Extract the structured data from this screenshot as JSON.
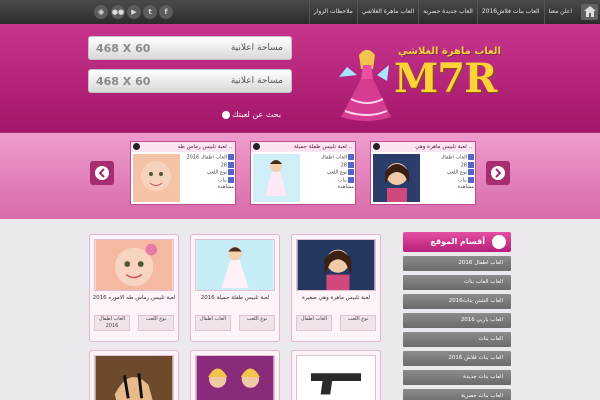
{
  "topbar": {
    "social_icons": [
      "facebook-icon",
      "twitter-icon",
      "youtube-icon",
      "flickr-icon",
      "rss-icon"
    ],
    "menu": [
      "اعلن معنا",
      "العاب بنات فلاش2016",
      "العاب جديدة حصرية",
      "العاب ماهرة الغلاشي",
      "ملاحظات الزوار"
    ]
  },
  "header": {
    "ads": [
      {
        "size": "468 X 60",
        "label": "مساحة اعلانية"
      },
      {
        "size": "468 X 60",
        "label": "مساحة اعلانية"
      }
    ],
    "logo_text": "M7R",
    "logo_arabic": "العاب ماهرة الغلاشي",
    "search_link": "بحث عن لعبتك"
  },
  "slider": {
    "cards": [
      {
        "title": "لعبة تلبيس رماس طه ..",
        "info": [
          "العاب اطفال 2016",
          "28",
          "نوع اللعب",
          "بنات",
          "مشاهدة"
        ]
      },
      {
        "title": "لعبة تلبيس طفلة جميلة ..",
        "info": [
          "العاب اطفال",
          "28",
          "نوع اللعب",
          "بنات",
          "مشاهدة"
        ]
      },
      {
        "title": "لعبة تلبيس ماهرة وهي ..",
        "info": [
          "العاب اطفال",
          "28",
          "نوع اللعب",
          "بنات",
          "مشاهدة"
        ]
      }
    ]
  },
  "main": {
    "cards": [
      {
        "title": "لعبة تلبيس رماس طه الاموره 2016",
        "btn_a": "العاب اطفال 2016",
        "btn_b": "نوع اللعب"
      },
      {
        "title": "لعبة تلبيس طفلة جميلة 2016",
        "btn_a": "العاب اطفال",
        "btn_b": "نوع اللعب"
      },
      {
        "title": "لعبة تلبيس ماهرة وهي صغيرة",
        "btn_a": "العاب اطفال",
        "btn_b": "نوع اللعب"
      }
    ]
  },
  "sidebar": {
    "title": "أقسام الموقع",
    "items": [
      "العاب اطفال 2016",
      "العاب العاب بنات",
      "العاب الشتن بنات2016",
      "العاب باربي 2016",
      "العاب بنات",
      "العاب بنات فلاش 2016",
      "العاب بنات جديدة",
      "العاب بنات حصرية"
    ]
  },
  "colors": {
    "brand": "#b81f78",
    "accent": "#ffd23a",
    "topbar": "#333333"
  }
}
